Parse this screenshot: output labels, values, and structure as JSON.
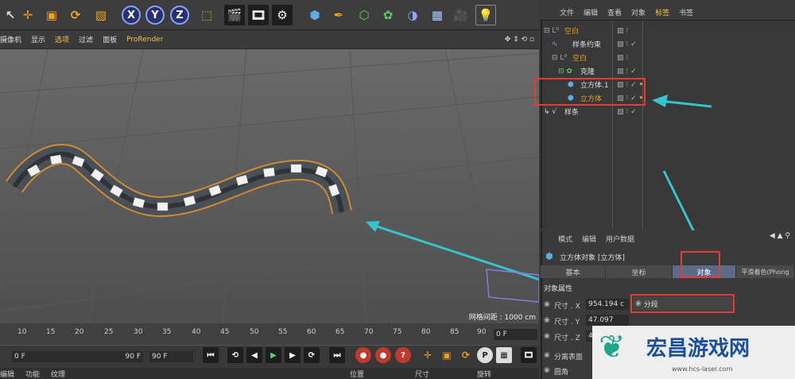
{
  "viewport_menu": [
    "摄像机",
    "显示",
    "选项",
    "过滤",
    "面板",
    "ProRender"
  ],
  "grid_spacing": "网格间距 : 1000 cm",
  "ruler": [
    "10",
    "15",
    "20",
    "25",
    "30",
    "35",
    "40",
    "45",
    "50",
    "55",
    "60",
    "65",
    "70",
    "75",
    "80",
    "85",
    "90"
  ],
  "frame_field": "0 F",
  "range_start": "0 F",
  "range_end": "90 F",
  "range_end2": "90 F",
  "bottom_tabs": [
    "编辑",
    "功能",
    "纹理"
  ],
  "coord_headers": [
    "位置",
    "尺寸",
    "旋转"
  ],
  "obj_menu": [
    "文件",
    "编辑",
    "查看",
    "对象",
    "标签",
    "书签"
  ],
  "objects": [
    {
      "name": "空白",
      "indent": 0,
      "color": "#e8a020"
    },
    {
      "name": "样条约束",
      "indent": 1,
      "color": "#dddddd"
    },
    {
      "name": "空白",
      "indent": 1,
      "color": "#e8a020"
    },
    {
      "name": "克隆",
      "indent": 1,
      "color": "#dddddd"
    },
    {
      "name": "立方体.1",
      "indent": 2,
      "color": "#dddddd"
    },
    {
      "name": "立方体",
      "indent": 2,
      "color": "#e8a020"
    },
    {
      "name": "样条",
      "indent": 0,
      "color": "#dddddd"
    }
  ],
  "attr_menu": [
    "模式",
    "编辑",
    "用户数据"
  ],
  "attr_title": "立方体对象 [立方体]",
  "attr_tabs": [
    "基本",
    "坐标",
    "对象",
    "平滑着色(Phong"
  ],
  "section": "对象属性",
  "size_x_label": "尺寸 . X",
  "size_x": "954.194 c",
  "size_y_label": "尺寸 . Y",
  "size_y": "47.097",
  "size_z_label": "尺寸 . Z",
  "size_z": "46",
  "seg_label": "分段",
  "sep_label": "分离表面",
  "fillet_label": "圆角",
  "watermark_text": "宏昌游戏网",
  "watermark_url": "www.hcs-laser.com"
}
